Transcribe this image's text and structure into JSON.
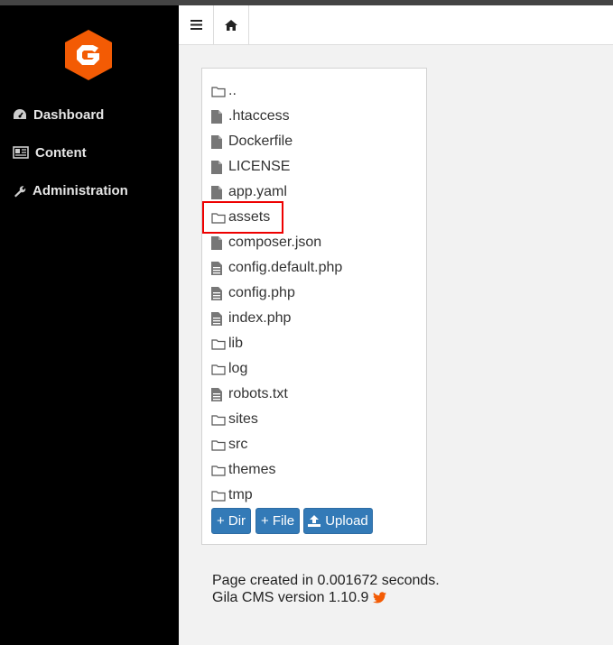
{
  "sidebar": {
    "logo_icon": "gila-hexagon-logo",
    "brand_color": "#f35b04",
    "items": [
      {
        "label": "Dashboard",
        "icon": "dashboard-icon"
      },
      {
        "label": "Content",
        "icon": "newspaper-icon"
      },
      {
        "label": "Administration",
        "icon": "wrench-icon"
      }
    ]
  },
  "topbar": {
    "menu_icon": "hamburger-icon",
    "home_icon": "home-icon"
  },
  "files": [
    {
      "name": "..",
      "type": "folder"
    },
    {
      "name": ".htaccess",
      "type": "file"
    },
    {
      "name": "Dockerfile",
      "type": "file"
    },
    {
      "name": "LICENSE",
      "type": "file"
    },
    {
      "name": "app.yaml",
      "type": "file"
    },
    {
      "name": "assets",
      "type": "folder"
    },
    {
      "name": "composer.json",
      "type": "file"
    },
    {
      "name": "config.default.php",
      "type": "text-file"
    },
    {
      "name": "config.php",
      "type": "text-file"
    },
    {
      "name": "index.php",
      "type": "text-file"
    },
    {
      "name": "lib",
      "type": "folder"
    },
    {
      "name": "log",
      "type": "folder"
    },
    {
      "name": "robots.txt",
      "type": "text-file"
    },
    {
      "name": "sites",
      "type": "folder"
    },
    {
      "name": "src",
      "type": "folder"
    },
    {
      "name": "themes",
      "type": "folder"
    },
    {
      "name": "tmp",
      "type": "folder"
    }
  ],
  "actions": {
    "add_dir": "+ Dir",
    "add_file": "+ File",
    "upload": "Upload",
    "accent": "#337ab7"
  },
  "footer": {
    "line1": "Page created in 0.001672 seconds.",
    "line2": "Gila CMS version 1.10.9",
    "twitter_color": "#f35b04"
  }
}
